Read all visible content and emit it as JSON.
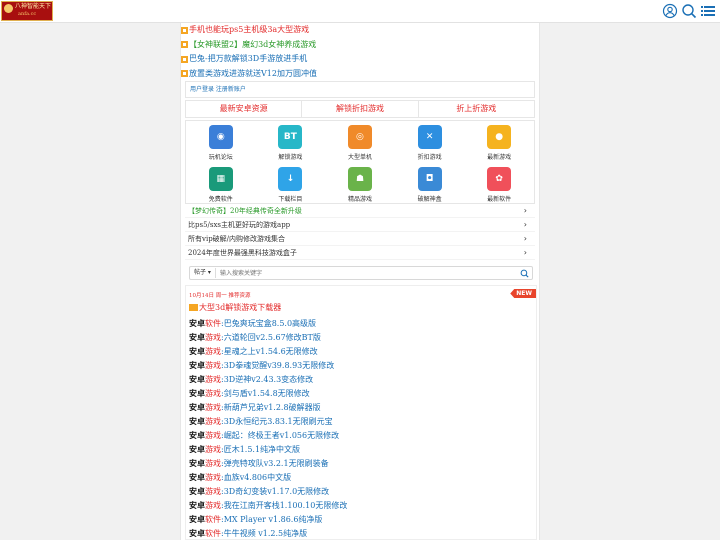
{
  "header": {
    "logo_text": "八神智能天下",
    "logo_sub": "anfa.cc",
    "icons": [
      "user-icon",
      "search-icon",
      "menu-icon"
    ]
  },
  "ads": [
    {
      "text": "手机也能玩ps5主机级3a大型游戏",
      "color": "#e32b2b"
    },
    {
      "text": "【女神联盟2】魔幻3d女神养成游戏",
      "color": "#2a9a2a"
    },
    {
      "text": "巴兔-把万款解锁3D手游放进手机",
      "color": "#1a6fb5"
    },
    {
      "text": "放置类游戏进游就送V12加万圆冲值",
      "color": "#1a6fb5"
    }
  ],
  "login": {
    "text": "用户登录 注册新账户"
  },
  "tabs": [
    "最新安卓资源",
    "解锁折扣游戏",
    "折上折游戏"
  ],
  "grid": [
    {
      "label": "玩机论坛",
      "icon": "forum-icon",
      "color": "#3b7fd8",
      "glyph": "◉"
    },
    {
      "label": "解锁游戏",
      "icon": "bt-game-icon",
      "color": "#27b7c8",
      "glyph": "BT"
    },
    {
      "label": "大型单机",
      "icon": "gamepad-icon",
      "color": "#f08a2a",
      "glyph": "◎"
    },
    {
      "label": "折扣游戏",
      "icon": "tools-icon",
      "color": "#2d8fe0",
      "glyph": "✕"
    },
    {
      "label": "最新游戏",
      "icon": "game-controller-icon",
      "color": "#f5b31f",
      "glyph": "●"
    },
    {
      "label": "免费软件",
      "icon": "grid-app-icon",
      "color": "#1a9a7a",
      "glyph": "▦"
    },
    {
      "label": "下载栏目",
      "icon": "download-icon",
      "color": "#2fa4e8",
      "glyph": "↓"
    },
    {
      "label": "精品游戏",
      "icon": "android-icon",
      "color": "#6ab34a",
      "glyph": "☗"
    },
    {
      "label": "破解神盒",
      "icon": "cup-icon",
      "color": "#3a8ad6",
      "glyph": "◘"
    },
    {
      "label": "最新软件",
      "icon": "star-app-icon",
      "color": "#f0505a",
      "glyph": "✿"
    }
  ],
  "list": [
    {
      "text": "【梦幻传奇】20年经典传奇全新升级",
      "color": "#2a9a2a"
    },
    {
      "text": "比ps5/sxs主机更好玩的游戏app",
      "color": "#333333"
    },
    {
      "text": "所有vip破解/内购修改游戏集合",
      "color": "#333333"
    },
    {
      "text": "2024年度世界最强黑科技游戏盒子",
      "color": "#333333"
    }
  ],
  "search": {
    "select": "帖子",
    "placeholder": "输入搜索关键字"
  },
  "news": {
    "date": "10月14日 周一  推荐资源",
    "badge": "NEW",
    "headline": "大型3d解锁游戏下载器",
    "items": [
      {
        "prefix": "安卓",
        "cat": "软件",
        "title": ":巴兔爽玩宝盒8.5.0高级版"
      },
      {
        "prefix": "安卓",
        "cat": "游戏",
        "title": ":六道轮回v2.5.67修改BT版"
      },
      {
        "prefix": "安卓",
        "cat": "游戏",
        "title": ":星魂之上v1.54.6无限修改"
      },
      {
        "prefix": "安卓",
        "cat": "游戏",
        "title": ":3D拳魂觉醒v39.8.93无限修改"
      },
      {
        "prefix": "安卓",
        "cat": "游戏",
        "title": ":3D逆神v2.43.3变态修改"
      },
      {
        "prefix": "安卓",
        "cat": "游戏",
        "title": ":剑与盾v1.54.8无限修改"
      },
      {
        "prefix": "安卓",
        "cat": "游戏",
        "title": ":新葫芦兄弟v1.2.8破解器版"
      },
      {
        "prefix": "安卓",
        "cat": "游戏",
        "title": ":3D永恒纪元3.83.1无限刷元宝"
      },
      {
        "prefix": "安卓",
        "cat": "游戏",
        "title": ":崛起：终极王者v1.056无限修改"
      },
      {
        "prefix": "安卓",
        "cat": "游戏",
        "title": ":匠木1.5.1纯净中文版"
      },
      {
        "prefix": "安卓",
        "cat": "游戏",
        "title": ":弹壳特攻队v3.2.1无限刷装备"
      },
      {
        "prefix": "安卓",
        "cat": "游戏",
        "title": ":血族v4.806中文版"
      },
      {
        "prefix": "安卓",
        "cat": "游戏",
        "title": ":3D奇幻变装v1.17.0无限修改"
      },
      {
        "prefix": "安卓",
        "cat": "游戏",
        "title": ":我在江南开客栈1.100.10无限修改"
      },
      {
        "prefix": "安卓",
        "cat": "软件",
        "title": ":MX Player v1.86.6纯净版"
      },
      {
        "prefix": "安卓",
        "cat": "软件",
        "title": ":牛牛视频 v1.2.5纯净版"
      }
    ]
  }
}
